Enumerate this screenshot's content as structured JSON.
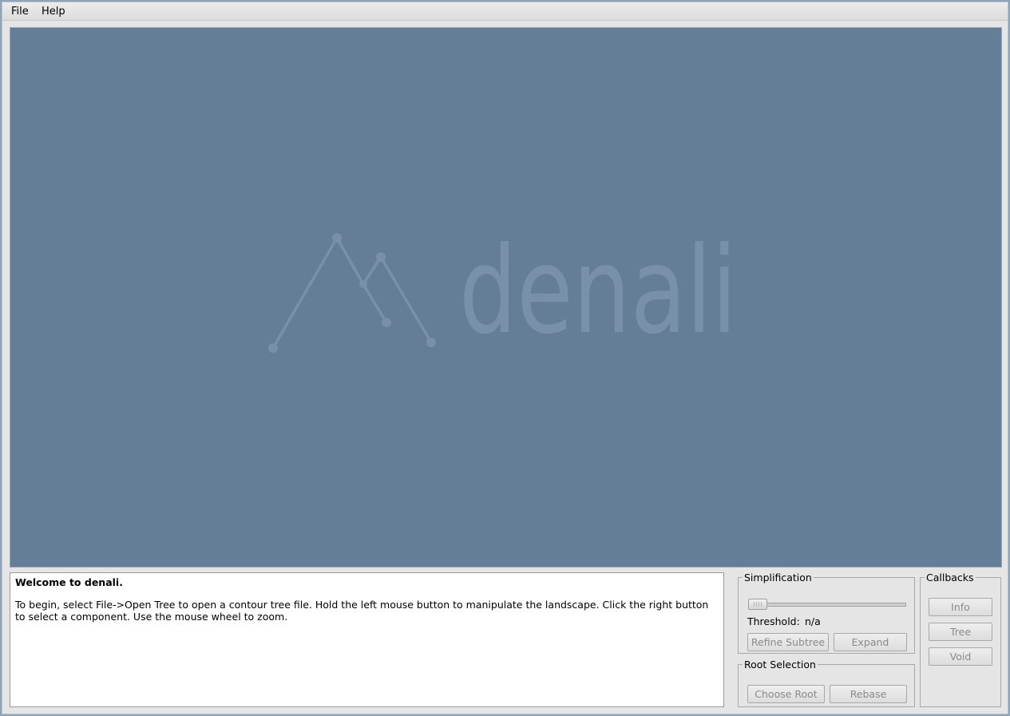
{
  "menu": {
    "file": "File",
    "help": "Help"
  },
  "logo": {
    "text": "denali"
  },
  "message": {
    "title": "Welcome to denali.",
    "body": "To begin, select File->Open Tree to open a contour tree file. Hold the left mouse button to manipulate the landscape. Click the right button to select a component. Use the mouse wheel to zoom."
  },
  "simplification": {
    "legend": "Simplification",
    "threshold_label": "Threshold:",
    "threshold_value": "n/a",
    "refine_label": "Refine Subtree",
    "expand_label": "Expand"
  },
  "root_selection": {
    "legend": "Root Selection",
    "choose_root_label": "Choose Root",
    "rebase_label": "Rebase"
  },
  "callbacks": {
    "legend": "Callbacks",
    "info_label": "Info",
    "tree_label": "Tree",
    "void_label": "Void"
  },
  "colors": {
    "viewport_bg": "#647e97",
    "logo": "#7890a8",
    "disabled_text": "#8a8a8a"
  }
}
